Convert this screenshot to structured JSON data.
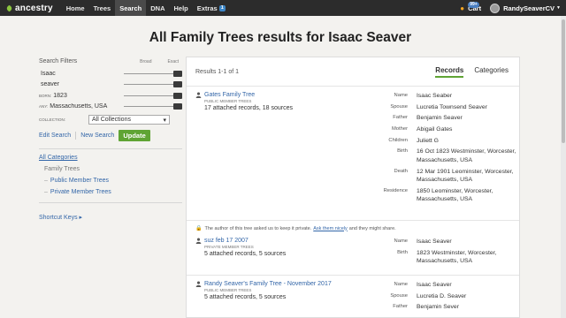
{
  "nav": {
    "logo": "ancestry",
    "items": [
      {
        "label": "Home"
      },
      {
        "label": "Trees"
      },
      {
        "label": "Search",
        "active": true
      },
      {
        "label": "DNA"
      },
      {
        "label": "Help"
      },
      {
        "label": "Extras"
      }
    ],
    "extras_badge": "1",
    "cart_label": "Cart",
    "cart_count": "99+",
    "user_name": "RandySeaverCV",
    "accent": "#5fa434"
  },
  "page": {
    "title": "All Family Trees results for Isaac Seaver"
  },
  "filters": {
    "heading": "Search Filters",
    "broad": "Broad",
    "exact": "Exact",
    "rows": [
      {
        "prefix": "",
        "value": "Isaac"
      },
      {
        "prefix": "",
        "value": "seaver"
      },
      {
        "prefix": "BORN:",
        "value": "1823"
      },
      {
        "prefix": "ANY:",
        "value": "Massachusetts, USA"
      }
    ],
    "collection_label": "COLLECTION:",
    "collection_value": "All Collections",
    "edit_search": "Edit Search",
    "new_search": "New Search",
    "update": "Update"
  },
  "categories": {
    "all": "All Categories",
    "family_trees": "Family Trees",
    "public": "Public Member Trees",
    "private": "Private Member Trees",
    "shortcut": "Shortcut Keys"
  },
  "results": {
    "count": "Results 1-1 of 1",
    "tab_records": "Records",
    "tab_categories": "Categories",
    "items": [
      {
        "title": "Gates Family Tree",
        "type": "PUBLIC MEMBER TREES",
        "count": "17 attached records, 18 sources",
        "facts": [
          {
            "k": "Name",
            "v": "Isaac Seaber"
          },
          {
            "k": "Spouse",
            "v": "Lucretia Townsend Seaver"
          },
          {
            "k": "Father",
            "v": "Benjamin Seaver"
          },
          {
            "k": "Mother",
            "v": "Abigail Gates"
          },
          {
            "k": "Children",
            "v": "Juliett G"
          },
          {
            "k": "Birth",
            "v": "16 Oct 1823 Westminster, Worcester, Massachusetts, USA"
          },
          {
            "k": "Death",
            "v": "12 Mar 1901 Leominster, Worcester, Massachusetts, USA"
          },
          {
            "k": "Residence",
            "v": "1850 Leominster, Worcester, Massachusetts, USA"
          }
        ]
      },
      {
        "notice_pre": "The author of this tree asked us to keep it private.",
        "notice_link": "Ask them nicely",
        "notice_post": "and they might share.",
        "title": "suz feb 17 2007",
        "type": "PRIVATE MEMBER TREES",
        "count": "5 attached records, 5 sources",
        "facts": [
          {
            "k": "Name",
            "v": "Isaac Seaver"
          },
          {
            "k": "Birth",
            "v": "1823 Westminster, Worcester, Massachusetts, USA"
          }
        ]
      },
      {
        "title": "Randy Seaver's Family Tree - November 2017",
        "type": "PUBLIC MEMBER TREES",
        "count": "5 attached records, 5 sources",
        "facts": [
          {
            "k": "Name",
            "v": "Isaac Seaver"
          },
          {
            "k": "Spouse",
            "v": "Lucretia D. Seaver"
          },
          {
            "k": "Father",
            "v": "Benjamin Sever"
          }
        ]
      }
    ]
  }
}
